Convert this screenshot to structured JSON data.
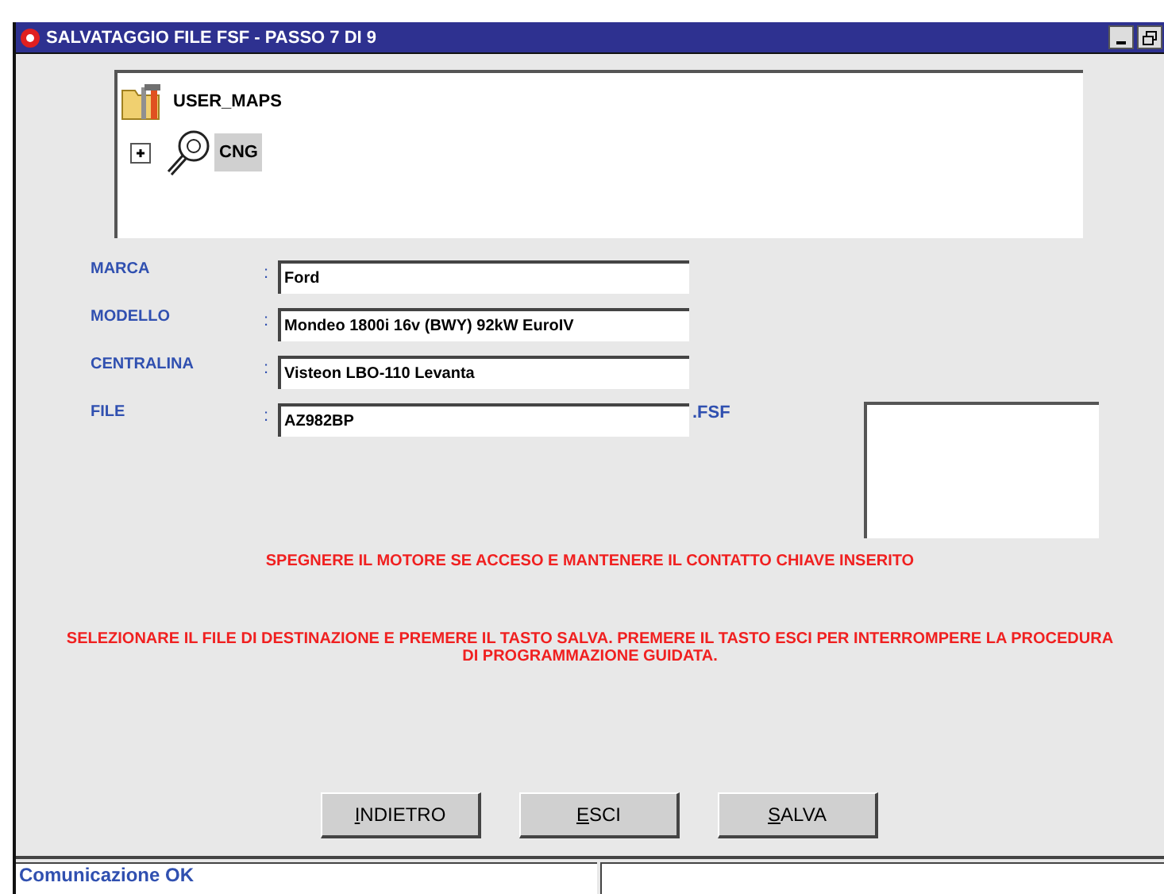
{
  "window": {
    "title": "SALVATAGGIO FILE FSF - PASSO 7 DI 9"
  },
  "tree": [
    {
      "label": "USER_MAPS",
      "kind": "folder",
      "selected": false,
      "children": [
        {
          "label": "CNG",
          "kind": "tool",
          "expanded": false,
          "selected": true
        }
      ]
    }
  ],
  "fields": [
    {
      "label": "MARCA",
      "separator": ":",
      "value": "Ford"
    },
    {
      "label": "MODELLO",
      "separator": ":",
      "value": "Mondeo 1800i 16v (BWY) 92kW EuroIV"
    },
    {
      "label": "CENTRALINA",
      "separator": ":",
      "value": "Visteon LBO-110 Levanta"
    },
    {
      "label": "FILE",
      "separator": ":",
      "value": "AZ982BP",
      "suffix": ".FSF"
    }
  ],
  "messages": [
    "SPEGNERE IL MOTORE SE ACCESO E MANTENERE IL CONTATTO CHIAVE INSERITO",
    "SELEZIONARE IL FILE DI DESTINAZIONE E PREMERE IL TASTO SALVA. PREMERE IL TASTO ESCI PER INTERROMPERE LA PROCEDURA DI PROGRAMMAZIONE GUIDATA."
  ],
  "buttons": [
    "INDIETRO",
    "ESCI",
    "SALVA"
  ],
  "status_bar": [
    "Comunicazione OK"
  ]
}
